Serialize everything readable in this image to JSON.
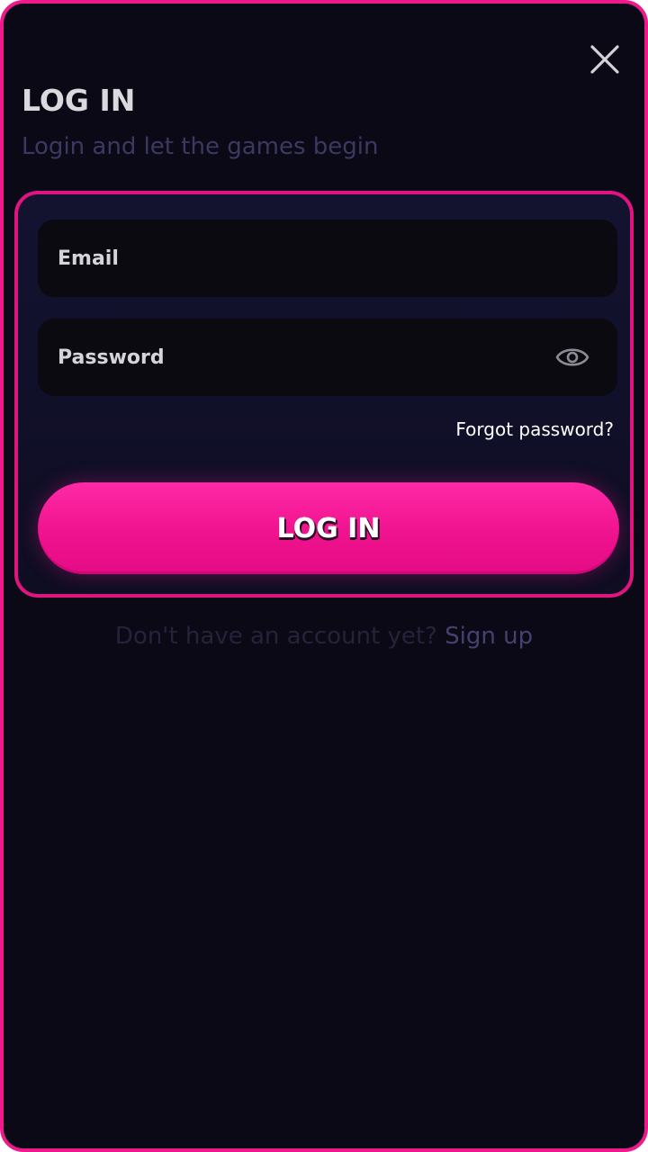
{
  "header": {
    "title": "LOG IN",
    "subtitle": "Login and let the games begin",
    "close_icon": "close-icon"
  },
  "form": {
    "email": {
      "value": "",
      "placeholder": "Email"
    },
    "password": {
      "value": "",
      "placeholder": "Password",
      "toggle_icon": "eye-icon"
    },
    "forgot_label": "Forgot password?",
    "submit_label": "LOG IN"
  },
  "footer": {
    "prompt": "Don't have an account yet?",
    "signup_label": "Sign up"
  },
  "colors": {
    "accent": "#ee1a8c",
    "background": "#0b0915",
    "card": "#131331",
    "field": "#0a0a10",
    "muted_text": "#3b3961"
  }
}
